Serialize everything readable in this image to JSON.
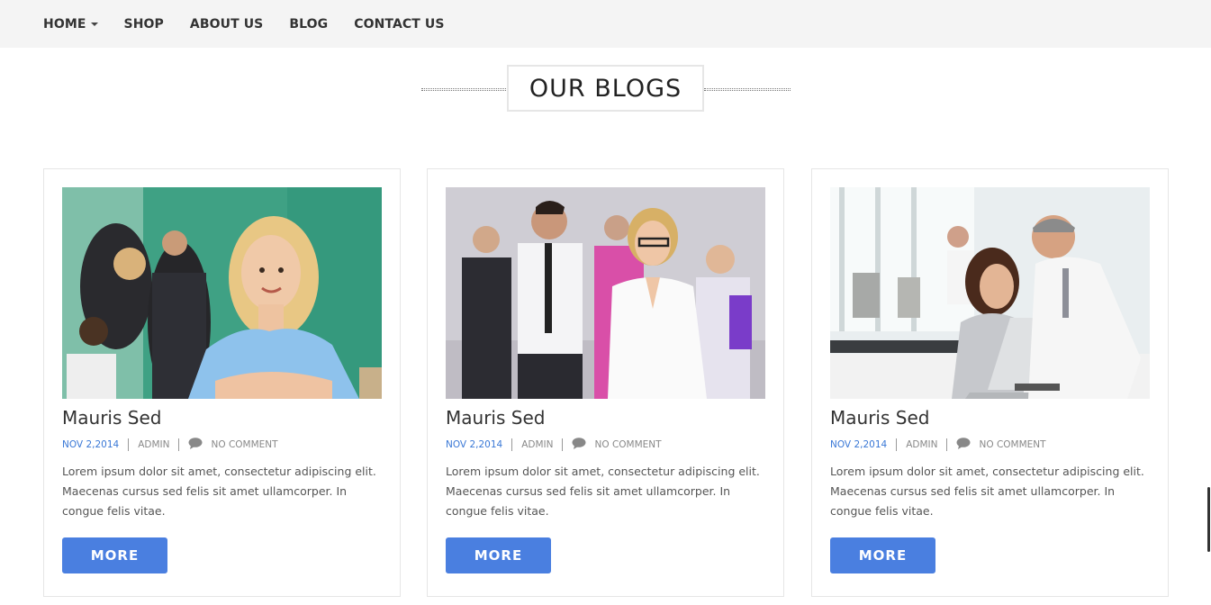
{
  "nav": {
    "items": [
      {
        "label": "HOME",
        "has_caret": true
      },
      {
        "label": "SHOP"
      },
      {
        "label": "ABOUT US"
      },
      {
        "label": "BLOG"
      },
      {
        "label": "CONTACT US"
      }
    ]
  },
  "section": {
    "title": "OUR BLOGS"
  },
  "posts": [
    {
      "title": "Mauris Sed",
      "date": "NOV 2,2014",
      "author": "ADMIN",
      "comments": "NO COMMENT",
      "excerpt": "Lorem ipsum dolor sit amet, consectetur adipiscing elit. Maecenas cursus sed felis sit amet ullamcorper. In congue felis vitae.",
      "button": "MORE"
    },
    {
      "title": "Mauris Sed",
      "date": "NOV 2,2014",
      "author": "ADMIN",
      "comments": "NO COMMENT",
      "excerpt": "Lorem ipsum dolor sit amet, consectetur adipiscing elit. Maecenas cursus sed felis sit amet ullamcorper. In congue felis vitae.",
      "button": "MORE"
    },
    {
      "title": "Mauris Sed",
      "date": "NOV 2,2014",
      "author": "ADMIN",
      "comments": "NO COMMENT",
      "excerpt": "Lorem ipsum dolor sit amet, consectetur adipiscing elit. Maecenas cursus sed felis sit amet ullamcorper. In congue felis vitae.",
      "button": "MORE"
    }
  ],
  "colors": {
    "accent": "#4a7fe0",
    "date": "#3a78d6",
    "nav_bg": "#f4f4f4"
  }
}
